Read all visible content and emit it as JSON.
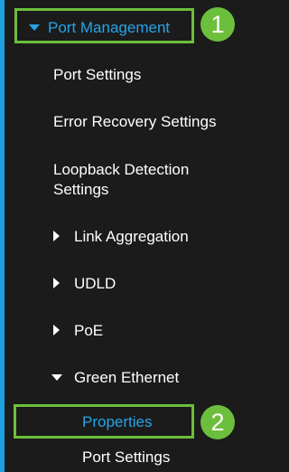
{
  "sidebar": {
    "port_management": "Port Management",
    "port_settings": "Port Settings",
    "error_recovery": "Error Recovery Settings",
    "loopback": "Loopback Detection Settings",
    "link_aggregation": "Link Aggregation",
    "udld": "UDLD",
    "poe": "PoE",
    "green_ethernet": "Green Ethernet",
    "properties": "Properties",
    "ge_port_settings": "Port Settings"
  },
  "callouts": {
    "step1": "1",
    "step2": "2"
  },
  "colors": {
    "background": "#1b1b1b",
    "accent_blue": "#27a4e8",
    "highlight_green": "#6cbf3c"
  },
  "icons": {
    "expanded": "caret-down-icon",
    "collapsed": "caret-right-icon"
  }
}
